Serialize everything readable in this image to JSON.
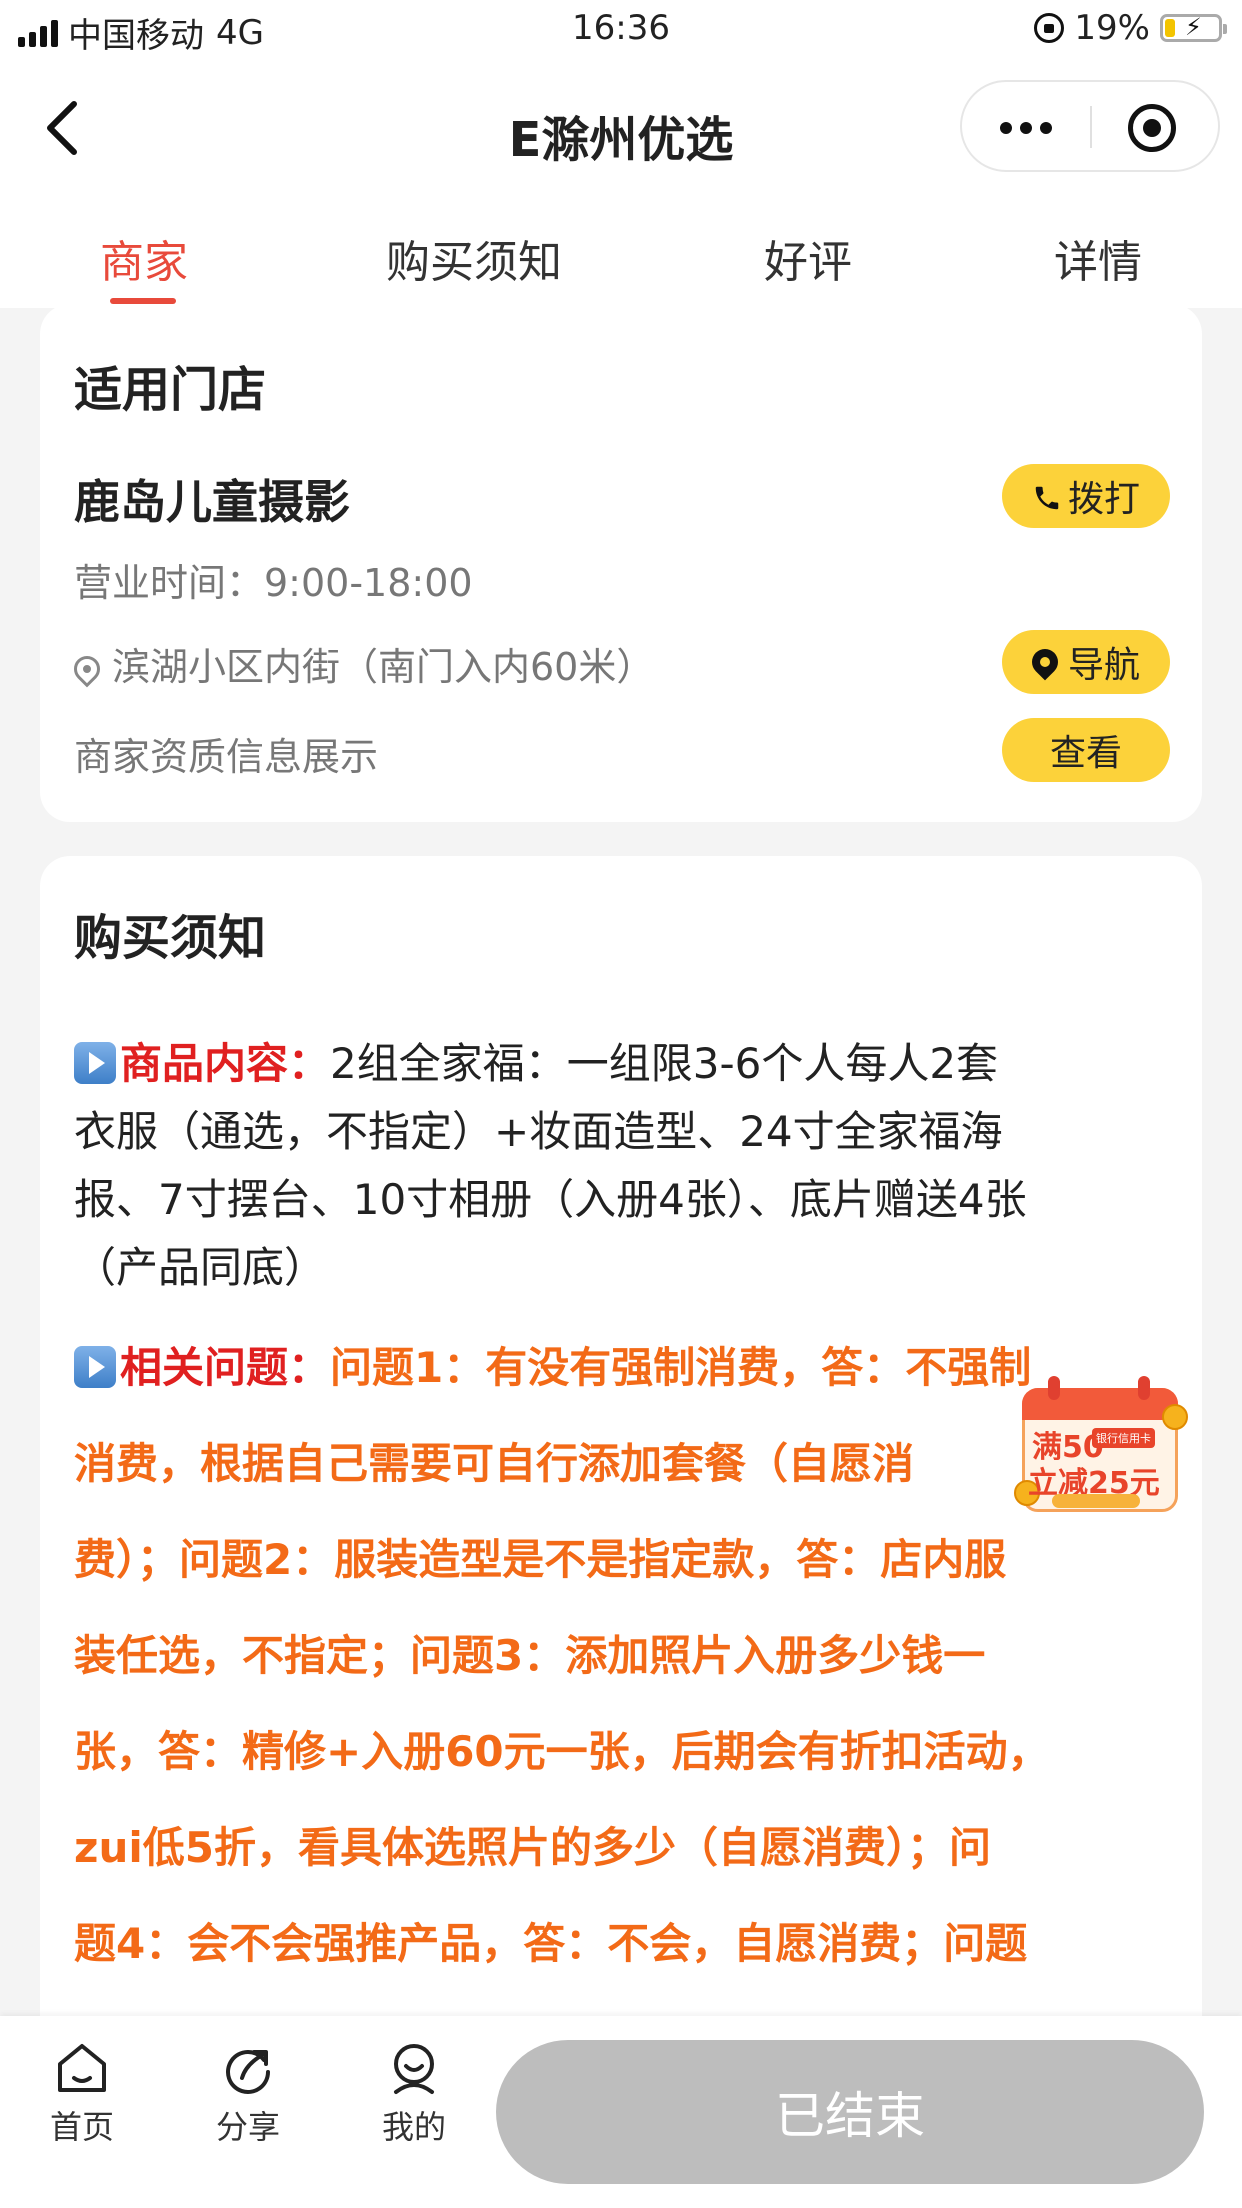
{
  "status_bar": {
    "carrier": "中国移动",
    "network": "4G",
    "time": "16:36",
    "battery_percent": "19%",
    "battery_level": 0.19,
    "icons": [
      "signal-icon",
      "orientation-lock-icon",
      "battery-charging-icon"
    ]
  },
  "nav": {
    "title": "E滁州优选",
    "back_icon": "chevron-left-icon",
    "more_icon": "more-dots-icon",
    "close_icon": "target-circle-icon"
  },
  "tabs": [
    {
      "label": "商家",
      "active": true
    },
    {
      "label": "购买须知",
      "active": false
    },
    {
      "label": "好评",
      "active": false
    },
    {
      "label": "详情",
      "active": false
    }
  ],
  "store": {
    "section_title": "适用门店",
    "name": "鹿岛儿童摄影",
    "call_label": "拨打",
    "hours": "营业时间：9:00-18:00",
    "address": "滨湖小区内街（南门入内60米）",
    "navigate_label": "导航",
    "qualification": "商家资质信息展示",
    "view_label": "查看"
  },
  "notice": {
    "section_title": "购买须知",
    "content_label": "商品内容：",
    "content_lines": [
      "2组全家福：一组限3-6个人每人2套",
      "衣服（通选，不指定）+妆面造型、24寸全家福海",
      "报、7寸摆台、10寸相册（入册4张）、底片赠送4张",
      "（产品同底）"
    ],
    "faq_label": "相关问题：",
    "faq_lines": [
      "问题1：有没有强制消费，答：不强制",
      "消费，根据自己需要可自行添加套餐（自愿消",
      "费）；问题2：服装造型是不是指定款，答：店内服",
      "装任选，不指定；问题3：添加照片入册多少钱一",
      "张，答：精修+入册60元一张，后期会有折扣活动，",
      "zui低5折，看具体选照片的多少（自愿消费）；问",
      "题4：会不会强推产品，答：不会，自愿消费；问题"
    ]
  },
  "coupon": {
    "line1": "满50",
    "tag": "银行信用卡",
    "line2": "立减25元"
  },
  "bottom_bar": {
    "items": [
      {
        "label": "首页",
        "icon": "home-icon"
      },
      {
        "label": "分享",
        "icon": "share-icon"
      },
      {
        "label": "我的",
        "icon": "profile-icon"
      }
    ],
    "ended_label": "已结束"
  },
  "colors": {
    "accent_red": "#e84a3b",
    "button_yellow": "#fcd23a",
    "faq_orange": "#f36a17",
    "disabled_gray": "#bdbdbd"
  }
}
